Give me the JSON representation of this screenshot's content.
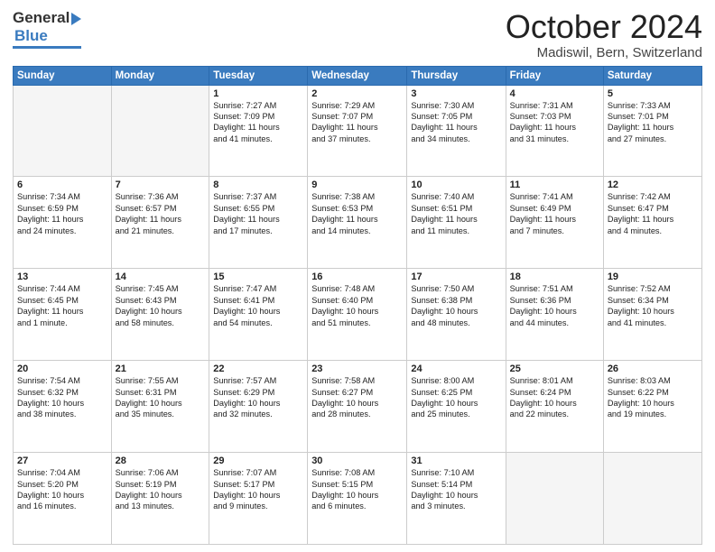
{
  "header": {
    "logo_general": "General",
    "logo_blue": "Blue",
    "month_title": "October 2024",
    "location": "Madiswil, Bern, Switzerland"
  },
  "weekdays": [
    "Sunday",
    "Monday",
    "Tuesday",
    "Wednesday",
    "Thursday",
    "Friday",
    "Saturday"
  ],
  "weeks": [
    [
      {
        "day": "",
        "lines": [],
        "empty": true
      },
      {
        "day": "",
        "lines": [],
        "empty": true
      },
      {
        "day": "1",
        "lines": [
          "Sunrise: 7:27 AM",
          "Sunset: 7:09 PM",
          "Daylight: 11 hours",
          "and 41 minutes."
        ],
        "empty": false
      },
      {
        "day": "2",
        "lines": [
          "Sunrise: 7:29 AM",
          "Sunset: 7:07 PM",
          "Daylight: 11 hours",
          "and 37 minutes."
        ],
        "empty": false
      },
      {
        "day": "3",
        "lines": [
          "Sunrise: 7:30 AM",
          "Sunset: 7:05 PM",
          "Daylight: 11 hours",
          "and 34 minutes."
        ],
        "empty": false
      },
      {
        "day": "4",
        "lines": [
          "Sunrise: 7:31 AM",
          "Sunset: 7:03 PM",
          "Daylight: 11 hours",
          "and 31 minutes."
        ],
        "empty": false
      },
      {
        "day": "5",
        "lines": [
          "Sunrise: 7:33 AM",
          "Sunset: 7:01 PM",
          "Daylight: 11 hours",
          "and 27 minutes."
        ],
        "empty": false
      }
    ],
    [
      {
        "day": "6",
        "lines": [
          "Sunrise: 7:34 AM",
          "Sunset: 6:59 PM",
          "Daylight: 11 hours",
          "and 24 minutes."
        ],
        "empty": false
      },
      {
        "day": "7",
        "lines": [
          "Sunrise: 7:36 AM",
          "Sunset: 6:57 PM",
          "Daylight: 11 hours",
          "and 21 minutes."
        ],
        "empty": false
      },
      {
        "day": "8",
        "lines": [
          "Sunrise: 7:37 AM",
          "Sunset: 6:55 PM",
          "Daylight: 11 hours",
          "and 17 minutes."
        ],
        "empty": false
      },
      {
        "day": "9",
        "lines": [
          "Sunrise: 7:38 AM",
          "Sunset: 6:53 PM",
          "Daylight: 11 hours",
          "and 14 minutes."
        ],
        "empty": false
      },
      {
        "day": "10",
        "lines": [
          "Sunrise: 7:40 AM",
          "Sunset: 6:51 PM",
          "Daylight: 11 hours",
          "and 11 minutes."
        ],
        "empty": false
      },
      {
        "day": "11",
        "lines": [
          "Sunrise: 7:41 AM",
          "Sunset: 6:49 PM",
          "Daylight: 11 hours",
          "and 7 minutes."
        ],
        "empty": false
      },
      {
        "day": "12",
        "lines": [
          "Sunrise: 7:42 AM",
          "Sunset: 6:47 PM",
          "Daylight: 11 hours",
          "and 4 minutes."
        ],
        "empty": false
      }
    ],
    [
      {
        "day": "13",
        "lines": [
          "Sunrise: 7:44 AM",
          "Sunset: 6:45 PM",
          "Daylight: 11 hours",
          "and 1 minute."
        ],
        "empty": false
      },
      {
        "day": "14",
        "lines": [
          "Sunrise: 7:45 AM",
          "Sunset: 6:43 PM",
          "Daylight: 10 hours",
          "and 58 minutes."
        ],
        "empty": false
      },
      {
        "day": "15",
        "lines": [
          "Sunrise: 7:47 AM",
          "Sunset: 6:41 PM",
          "Daylight: 10 hours",
          "and 54 minutes."
        ],
        "empty": false
      },
      {
        "day": "16",
        "lines": [
          "Sunrise: 7:48 AM",
          "Sunset: 6:40 PM",
          "Daylight: 10 hours",
          "and 51 minutes."
        ],
        "empty": false
      },
      {
        "day": "17",
        "lines": [
          "Sunrise: 7:50 AM",
          "Sunset: 6:38 PM",
          "Daylight: 10 hours",
          "and 48 minutes."
        ],
        "empty": false
      },
      {
        "day": "18",
        "lines": [
          "Sunrise: 7:51 AM",
          "Sunset: 6:36 PM",
          "Daylight: 10 hours",
          "and 44 minutes."
        ],
        "empty": false
      },
      {
        "day": "19",
        "lines": [
          "Sunrise: 7:52 AM",
          "Sunset: 6:34 PM",
          "Daylight: 10 hours",
          "and 41 minutes."
        ],
        "empty": false
      }
    ],
    [
      {
        "day": "20",
        "lines": [
          "Sunrise: 7:54 AM",
          "Sunset: 6:32 PM",
          "Daylight: 10 hours",
          "and 38 minutes."
        ],
        "empty": false
      },
      {
        "day": "21",
        "lines": [
          "Sunrise: 7:55 AM",
          "Sunset: 6:31 PM",
          "Daylight: 10 hours",
          "and 35 minutes."
        ],
        "empty": false
      },
      {
        "day": "22",
        "lines": [
          "Sunrise: 7:57 AM",
          "Sunset: 6:29 PM",
          "Daylight: 10 hours",
          "and 32 minutes."
        ],
        "empty": false
      },
      {
        "day": "23",
        "lines": [
          "Sunrise: 7:58 AM",
          "Sunset: 6:27 PM",
          "Daylight: 10 hours",
          "and 28 minutes."
        ],
        "empty": false
      },
      {
        "day": "24",
        "lines": [
          "Sunrise: 8:00 AM",
          "Sunset: 6:25 PM",
          "Daylight: 10 hours",
          "and 25 minutes."
        ],
        "empty": false
      },
      {
        "day": "25",
        "lines": [
          "Sunrise: 8:01 AM",
          "Sunset: 6:24 PM",
          "Daylight: 10 hours",
          "and 22 minutes."
        ],
        "empty": false
      },
      {
        "day": "26",
        "lines": [
          "Sunrise: 8:03 AM",
          "Sunset: 6:22 PM",
          "Daylight: 10 hours",
          "and 19 minutes."
        ],
        "empty": false
      }
    ],
    [
      {
        "day": "27",
        "lines": [
          "Sunrise: 7:04 AM",
          "Sunset: 5:20 PM",
          "Daylight: 10 hours",
          "and 16 minutes."
        ],
        "empty": false
      },
      {
        "day": "28",
        "lines": [
          "Sunrise: 7:06 AM",
          "Sunset: 5:19 PM",
          "Daylight: 10 hours",
          "and 13 minutes."
        ],
        "empty": false
      },
      {
        "day": "29",
        "lines": [
          "Sunrise: 7:07 AM",
          "Sunset: 5:17 PM",
          "Daylight: 10 hours",
          "and 9 minutes."
        ],
        "empty": false
      },
      {
        "day": "30",
        "lines": [
          "Sunrise: 7:08 AM",
          "Sunset: 5:15 PM",
          "Daylight: 10 hours",
          "and 6 minutes."
        ],
        "empty": false
      },
      {
        "day": "31",
        "lines": [
          "Sunrise: 7:10 AM",
          "Sunset: 5:14 PM",
          "Daylight: 10 hours",
          "and 3 minutes."
        ],
        "empty": false
      },
      {
        "day": "",
        "lines": [],
        "empty": true
      },
      {
        "day": "",
        "lines": [],
        "empty": true
      }
    ]
  ]
}
